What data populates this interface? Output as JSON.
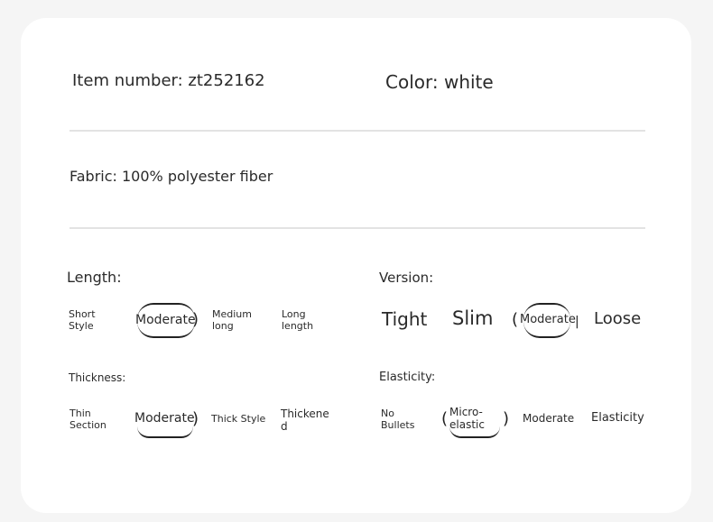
{
  "header": {
    "item_number": "Item number: zt252162",
    "color": "Color: white"
  },
  "fabric": "Fabric: 100% polyester fiber",
  "length": {
    "title": "Length:",
    "options": [
      "Short Style",
      "Moderate",
      "Medium long",
      "Long length"
    ],
    "selected": "Moderate"
  },
  "version": {
    "title": "Version:",
    "options": [
      "Tight",
      "Slim",
      "Moderate",
      "Loose"
    ],
    "selected": "Moderate"
  },
  "thickness": {
    "title": "Thickness:",
    "options": [
      "Thin Section",
      "Moderate",
      "Thick Style",
      "Thickene d"
    ],
    "selected": "Moderate"
  },
  "elasticity": {
    "title": "Elasticity:",
    "options": [
      "No Bullets",
      "Micro-elastic",
      "Moderate",
      "Elasticity"
    ],
    "selected": "Micro-elastic"
  },
  "colors": {
    "card": "#ffffff",
    "background": "#f5f5f5",
    "divider": "#e3e3e3",
    "text": "#2a2a2a"
  }
}
